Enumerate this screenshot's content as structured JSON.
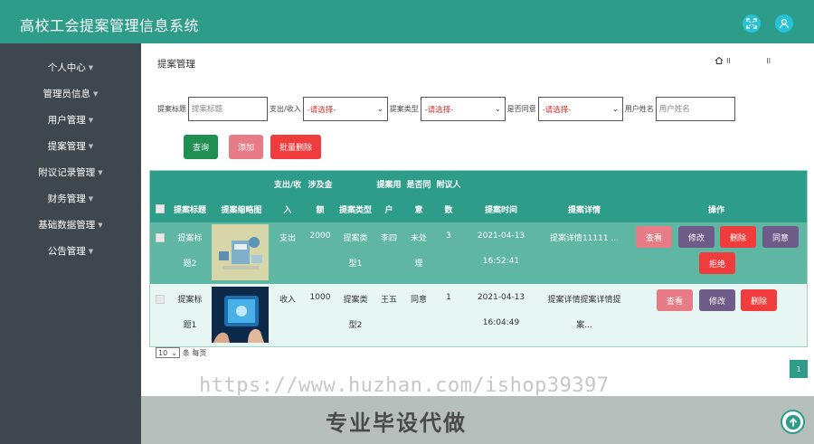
{
  "app": {
    "title": "高校工会提案管理信息系统"
  },
  "sidebar": {
    "items": [
      {
        "label": "个人中心"
      },
      {
        "label": "管理员信息"
      },
      {
        "label": "用户管理"
      },
      {
        "label": "提案管理"
      },
      {
        "label": "附议记录管理"
      },
      {
        "label": "财务管理"
      },
      {
        "label": "基础数据管理"
      },
      {
        "label": "公告管理"
      }
    ]
  },
  "page": {
    "title": "提案管理",
    "crumb1": "ll",
    "crumb2": "ll"
  },
  "filters": {
    "title_label": "提案标题",
    "title_placeholder": "提案标题",
    "io_label": "支出/收入",
    "io_value": "-请选择-",
    "type_label": "提案类型",
    "type_value": "-请选择-",
    "agree_label": "是否同意",
    "agree_value": "-请选择-",
    "user_label": "用户姓名",
    "user_placeholder": "用户姓名"
  },
  "buttons": {
    "search": "查询",
    "add": "添加",
    "batch_delete": "批量删除"
  },
  "table": {
    "headers": {
      "title": "提案标题",
      "thumb": "提案缩略图",
      "io_top": "支出/收",
      "io_bottom": "入",
      "amount_top": "涉及金",
      "amount_bottom": "额",
      "type": "提案类型",
      "user_top": "提案用",
      "user_bottom": "户",
      "agree_top": "是否同",
      "agree_bottom": "意",
      "count_top": "附议人",
      "count_bottom": "数",
      "time": "提案时间",
      "detail": "提案详情",
      "ops": "操作"
    },
    "rows": [
      {
        "title_l1": "提案标",
        "title_l2": "题2",
        "io": "支出",
        "amount": "2000",
        "type_l1": "提案类",
        "type_l2": "型1",
        "user": "李四",
        "agree_l1": "未处",
        "agree_l2": "理",
        "count": "3",
        "date": "2021-04-13",
        "time": "16:52:41",
        "detail_l1": "提案详情11111 ...",
        "detail_l2": "",
        "actions": {
          "view": "查看",
          "edit": "修改",
          "delete": "删除",
          "agree": "同意",
          "reject": "拒绝"
        }
      },
      {
        "title_l1": "提案标",
        "title_l2": "题1",
        "io": "收入",
        "amount": "1000",
        "type_l1": "提案类",
        "type_l2": "型2",
        "user": "王五",
        "agree_l1": "同意",
        "agree_l2": "",
        "count": "1",
        "date": "2021-04-13",
        "time": "16:04:49",
        "detail_l1": "提案详情提案详情提",
        "detail_l2": "案...",
        "actions": {
          "view": "查看",
          "edit": "修改",
          "delete": "删除"
        }
      }
    ]
  },
  "pager": {
    "page_size": "10",
    "per_page_label": "条 每页",
    "current_page": "1"
  },
  "watermark": "https://www.huzhan.com/ishop39397",
  "slogan": "专业毕设代做",
  "colors": {
    "primary": "#2d9c89",
    "sidebar": "#3f474e",
    "danger": "#f03c3c",
    "purple": "#6e5b87",
    "pink": "#e87c86"
  }
}
